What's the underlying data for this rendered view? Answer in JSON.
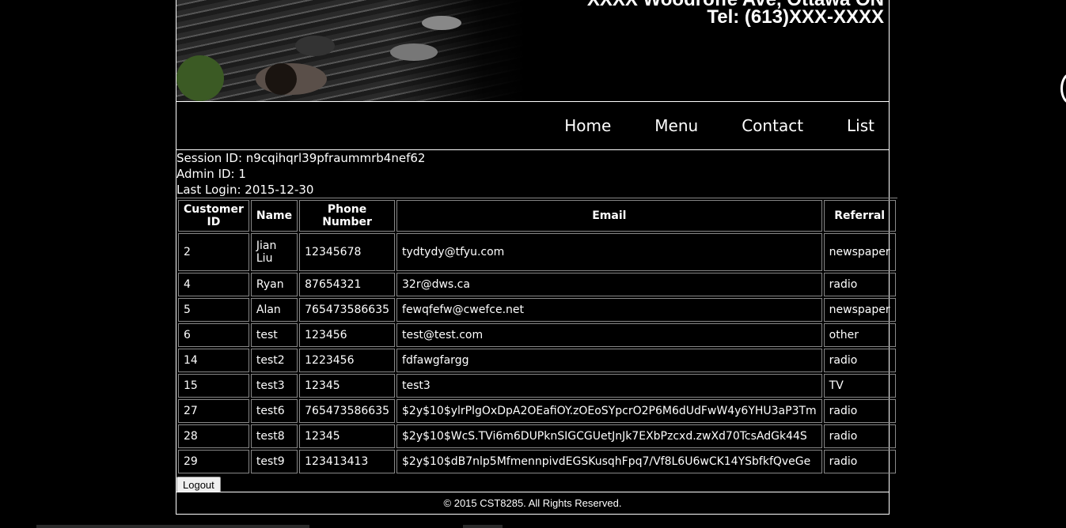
{
  "header": {
    "address": "XXXX Woodroffe Ave, Ottawa ON",
    "tel": "Tel: (613)XXX-XXXX"
  },
  "nav": {
    "items": [
      "Home",
      "Menu",
      "Contact",
      "List"
    ]
  },
  "session": {
    "session_id": "Session ID: n9cqihqrl39pfraummrb4nef62",
    "admin_id": "Admin ID: 1",
    "last_login": "Last Login: 2015-12-30"
  },
  "table": {
    "headers": [
      "Customer ID",
      "Name",
      "Phone Number",
      "Email",
      "Referral"
    ],
    "rows": [
      [
        "2",
        "Jian Liu",
        "12345678",
        "tydtydy@tfyu.com",
        "newspaper"
      ],
      [
        "4",
        "Ryan",
        "87654321",
        "32r@dws.ca",
        "radio"
      ],
      [
        "5",
        "Alan",
        "765473586635",
        "fewqfefw@cwefce.net",
        "newspaper"
      ],
      [
        "6",
        "test",
        "123456",
        "test@test.com",
        "other"
      ],
      [
        "14",
        "test2",
        "1223456",
        "fdfawgfargg",
        "radio"
      ],
      [
        "15",
        "test3",
        "12345",
        "test3",
        "TV"
      ],
      [
        "27",
        "test6",
        "765473586635",
        "$2y$10$ylrPlgOxDpA2OEafiOY.zOEoSYpcrO2P6M6dUdFwW4y6YHU3aP3Tm",
        "radio"
      ],
      [
        "28",
        "test8",
        "12345",
        "$2y$10$WcS.TVi6m6DUPknSIGCGUetJnJk7EXbPzcxd.zwXd70TcsAdGk44S",
        "radio"
      ],
      [
        "29",
        "test9",
        "123413413",
        "$2y$10$dB7nlp5MfmennpivdEGSKusqhFpq7/Vf8L6U6wCK14YSbfkfQveGe",
        "radio"
      ]
    ]
  },
  "logout_label": "Logout",
  "footer": "© 2015 CST8285. All Rights Reserved."
}
